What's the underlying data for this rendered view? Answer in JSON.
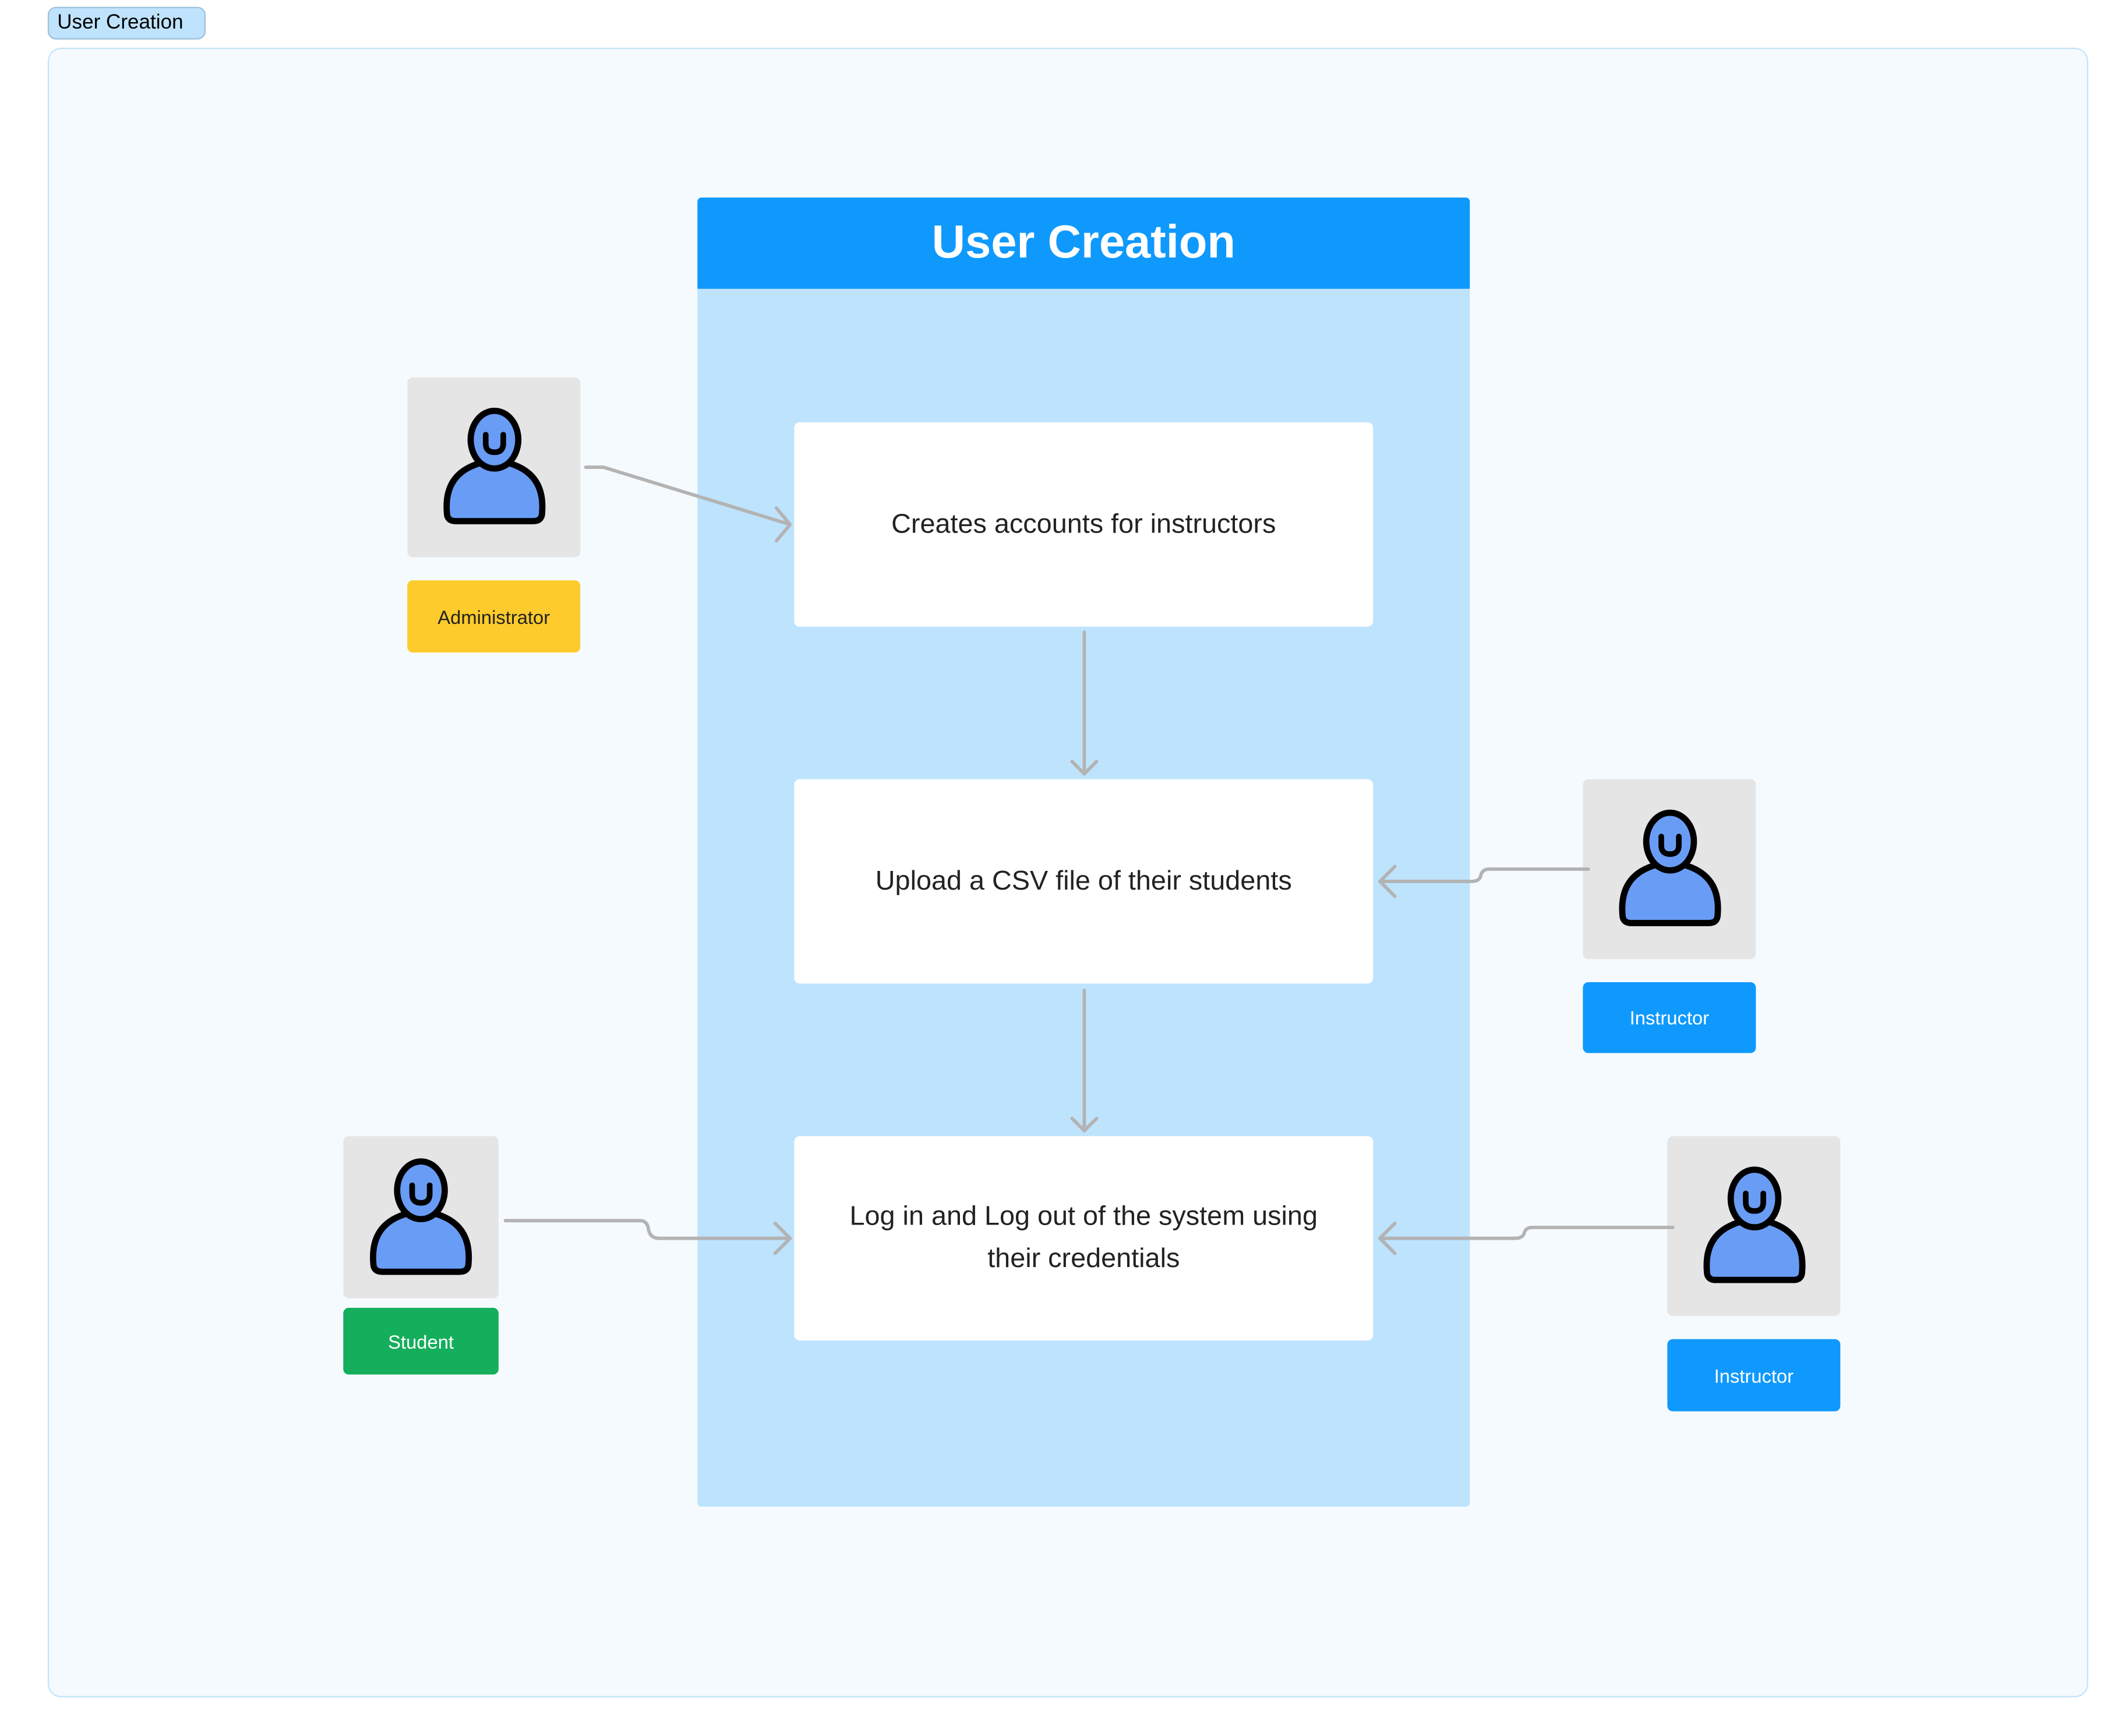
{
  "frame_tag": "User Creation",
  "lane": {
    "title": "User Creation"
  },
  "steps": [
    "Creates accounts for instructors",
    "Upload a CSV file of their students",
    "Log in and Log out of the system using their credentials"
  ],
  "actors": [
    {
      "role": "Administrator",
      "color": "#fdcb2b",
      "text_color": "#222222"
    },
    {
      "role": "Instructor",
      "color": "#0f99fd",
      "text_color": "#ffffff"
    },
    {
      "role": "Student",
      "color": "#14ae5c",
      "text_color": "#ffffff"
    },
    {
      "role": "Instructor",
      "color": "#0f99fd",
      "text_color": "#ffffff"
    }
  ],
  "colors": {
    "lane_header": "#0f99fd",
    "lane_body": "#bee3fd",
    "person_fill": "#699cf5",
    "arrow": "#b3b3b3"
  }
}
